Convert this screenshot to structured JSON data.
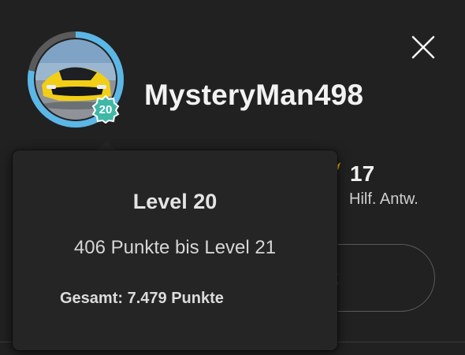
{
  "profile": {
    "username": "MysteryMan498",
    "level_badge": "20",
    "level_progress": 0.78
  },
  "stats": {
    "value": "17",
    "label": "Hilf. Antw."
  },
  "background_button": {
    "label_partial": "rt"
  },
  "tooltip": {
    "title": "Level 20",
    "subtitle": "406 Punkte bis Level 21",
    "total": "Gesamt: 7.479 Punkte"
  },
  "colors": {
    "background": "#212121",
    "tooltip_bg": "#252525",
    "progress_ring": "#5bb7e6",
    "ring_track": "#5a5a5a",
    "badge": "#3fb8a6",
    "link": "#4db6ee",
    "star": "#f5b400"
  },
  "icons": {
    "close": "close-icon",
    "badge": "level-badge-icon",
    "star": "star-icon"
  }
}
